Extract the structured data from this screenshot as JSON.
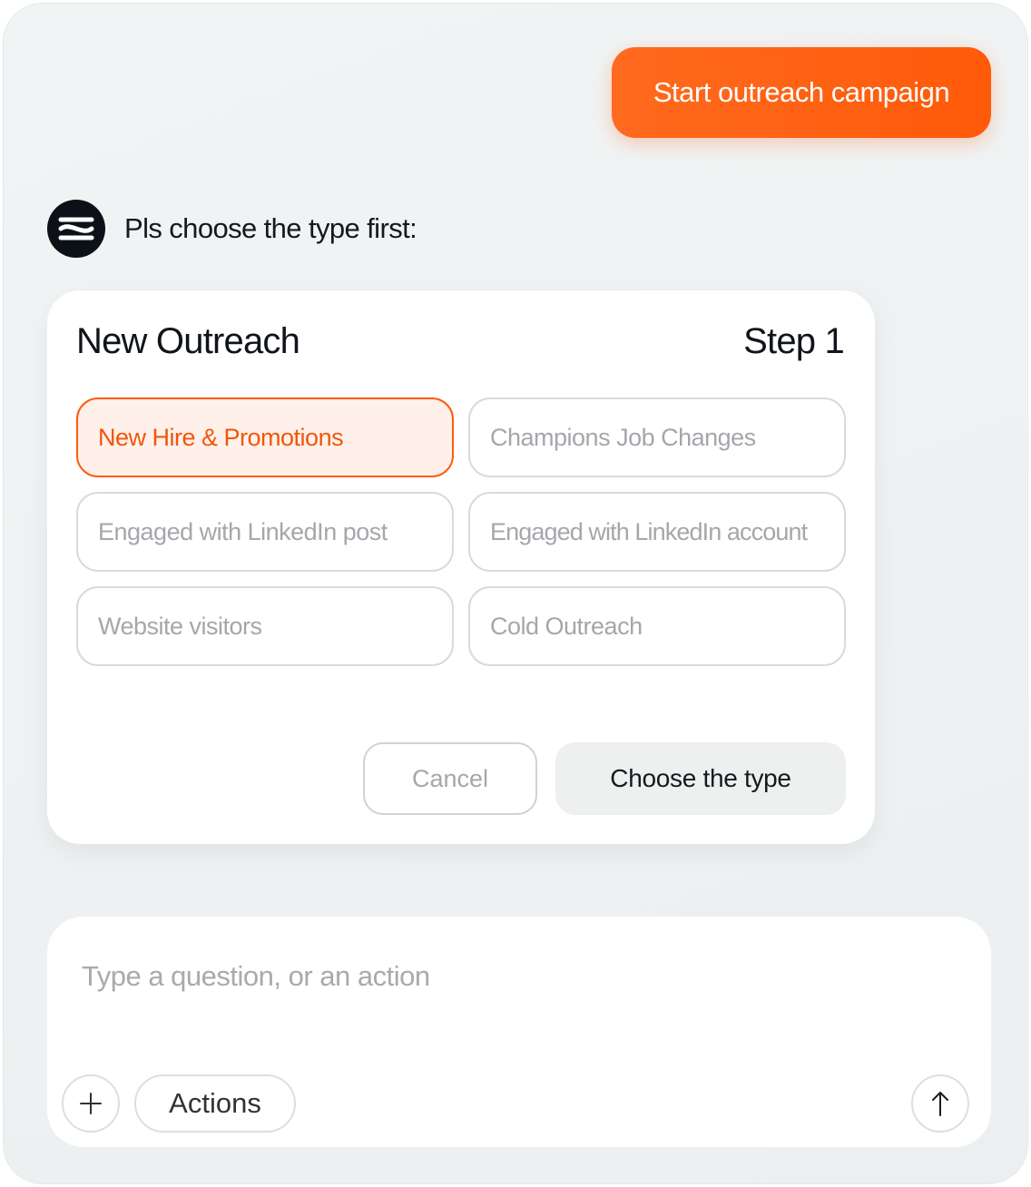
{
  "chat": {
    "user_message": "Start outreach campaign",
    "bot_message": "Pls choose the type first:"
  },
  "card": {
    "title": "New Outreach",
    "step": "Step 1",
    "options": [
      {
        "label": "New Hire & Promotions",
        "selected": true
      },
      {
        "label": "Champions Job Changes",
        "selected": false
      },
      {
        "label": "Engaged with LinkedIn post",
        "selected": false
      },
      {
        "label": "Engaged with LinkedIn account",
        "selected": false
      },
      {
        "label": "Website visitors",
        "selected": false
      },
      {
        "label": "Cold Outreach",
        "selected": false
      }
    ],
    "cancel_label": "Cancel",
    "confirm_label": "Choose the type"
  },
  "composer": {
    "placeholder": "Type a question, or an action",
    "actions_label": "Actions"
  },
  "icons": {
    "avatar": "brand-logo-icon",
    "add": "plus-icon",
    "send": "arrow-up-icon"
  },
  "colors": {
    "accent": "#ff5a09",
    "selected_bg": "#fff1ea",
    "avatar_bg": "#0c1118"
  }
}
